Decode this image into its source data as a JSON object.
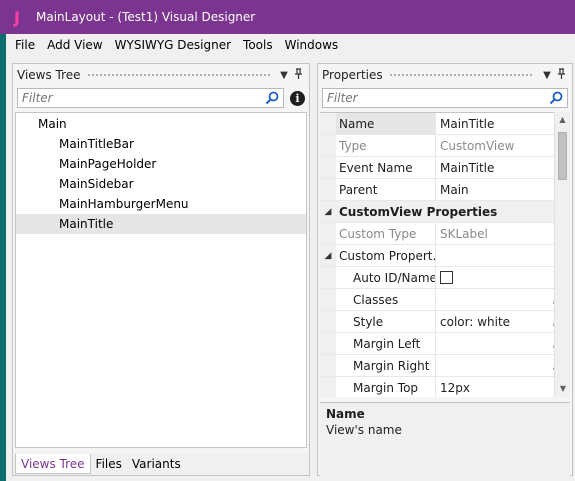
{
  "window": {
    "title": "MainLayout - (Test1) Visual Designer",
    "logo": "J"
  },
  "menu": [
    "File",
    "Add View",
    "WYSIWYG Designer",
    "Tools",
    "Windows"
  ],
  "views_tree": {
    "title": "Views Tree",
    "filter_placeholder": "Filter",
    "root": "Main",
    "children": [
      "MainTitleBar",
      "MainPageHolder",
      "MainSidebar",
      "MainHamburgerMenu",
      "MainTitle"
    ],
    "selected": "MainTitle",
    "tabs": [
      "Views Tree",
      "Files",
      "Variants"
    ],
    "active_tab": "Views Tree"
  },
  "properties": {
    "title": "Properties",
    "filter_placeholder": "Filter",
    "rows": {
      "name": {
        "label": "Name",
        "value": "MainTitle"
      },
      "type": {
        "label": "Type",
        "value": "CustomView"
      },
      "event_name": {
        "label": "Event Name",
        "value": "MainTitle"
      },
      "parent": {
        "label": "Parent",
        "value": "Main"
      },
      "category": {
        "label": "CustomView Properties"
      },
      "custom_type": {
        "label": "Custom Type",
        "value": "SKLabel"
      },
      "custom_props": {
        "label": "Custom Propert..."
      },
      "auto_id": {
        "label": "Auto ID/Name"
      },
      "classes": {
        "label": "Classes",
        "value": ""
      },
      "style": {
        "label": "Style",
        "value": "color: white"
      },
      "margin_left": {
        "label": "Margin Left",
        "value": ""
      },
      "margin_right": {
        "label": "Margin Right",
        "value": ""
      },
      "margin_top": {
        "label": "Margin Top",
        "value": "12px"
      }
    },
    "ellipsis": "...",
    "description": {
      "title": "Name",
      "text": "View's name"
    }
  },
  "colors": {
    "titlebar": "#7b3590",
    "accent": "#7b3590",
    "logo": "#ff3ea5",
    "search_icon": "#1d5ec9"
  }
}
